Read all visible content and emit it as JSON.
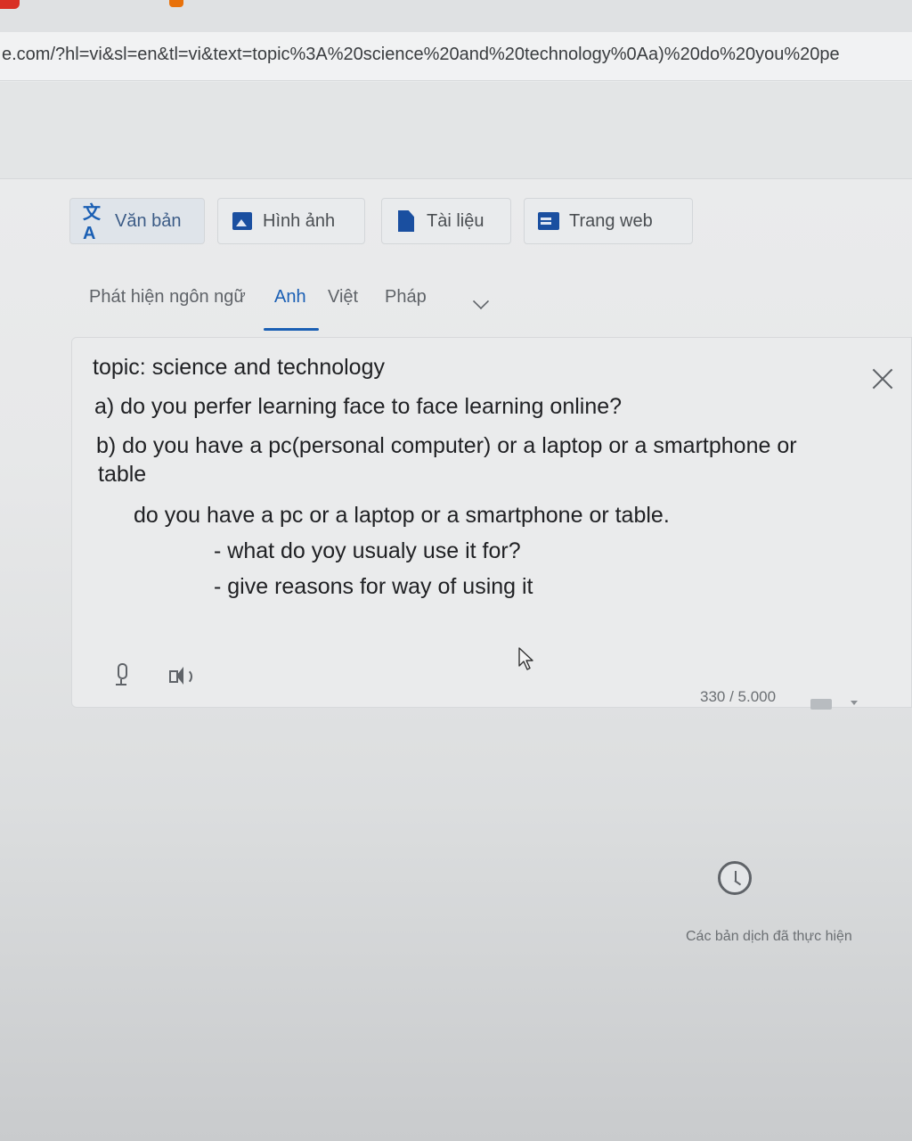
{
  "browser": {
    "url": "e.com/?hl=vi&sl=en&tl=vi&text=topic%3A%20science%20and%20technology%0Aa)%20do%20you%20pe"
  },
  "modes": [
    {
      "label": "Văn bản",
      "icon": "translate-icon",
      "active": true
    },
    {
      "label": "Hình ảnh",
      "icon": "image-icon",
      "active": false
    },
    {
      "label": "Tài liệu",
      "icon": "document-icon",
      "active": false
    },
    {
      "label": "Trang web",
      "icon": "website-icon",
      "active": false
    }
  ],
  "languages": {
    "detect": "Phát hiện ngôn ngữ",
    "items": [
      "Anh",
      "Việt",
      "Pháp"
    ],
    "selected": "Anh"
  },
  "source": {
    "lines": [
      "topic: science and technology",
      "a) do you perfer learning face to face learning online?",
      "b) do you have a pc(personal computer) or a laptop or a smartphone or",
      "table",
      "do you have a pc or a laptop or a smartphone or table.",
      "- what do yoy usualy use it for?",
      "- give reasons for way of using it"
    ],
    "char_count": "330 / 5.000"
  },
  "history": {
    "label": "Các bản dịch đã thực hiện"
  },
  "colors": {
    "accent": "#1a5fb4",
    "text": "#202124",
    "muted": "#5f6368"
  }
}
